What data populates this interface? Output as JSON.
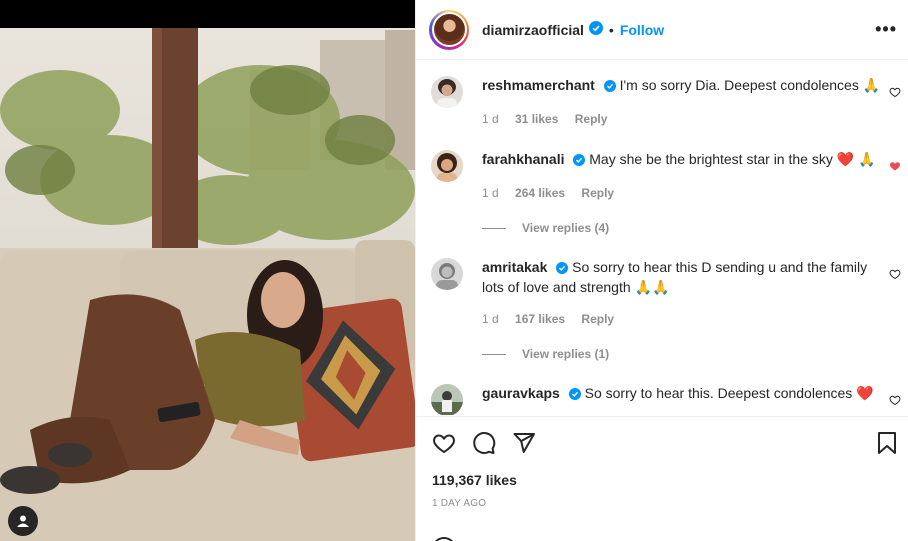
{
  "post": {
    "username": "diamirzaofficial",
    "follow_label": "Follow",
    "dot": "•",
    "more_label": "•••",
    "likes": "119,367 likes",
    "time_ago": "1 DAY AGO"
  },
  "comments": [
    {
      "username": "reshmamerchant",
      "text": "I'm so sorry Dia. Deepest condolences 🙏",
      "age": "1 d",
      "likes": "31 likes",
      "reply_label": "Reply",
      "liked": false
    },
    {
      "username": "farahkhanali",
      "text": "May she be the brightest star in the sky ❤️ 🙏",
      "age": "1 d",
      "likes": "264 likes",
      "reply_label": "Reply",
      "view_replies": "View replies (4)",
      "liked": true
    },
    {
      "username": "amritakak",
      "text": "So sorry to hear this D sending u and the family lots of love and strength 🙏🙏",
      "age": "1 d",
      "likes": "167 likes",
      "reply_label": "Reply",
      "view_replies": "View replies (1)",
      "liked": false
    },
    {
      "username": "gauravkaps",
      "text": "So sorry to hear this. Deepest condolences ❤️",
      "liked": false
    }
  ],
  "icons": {
    "verified": "verified-badge-icon",
    "like": "heart-icon",
    "comment": "comment-icon",
    "share": "share-icon",
    "save": "bookmark-icon",
    "tag": "user-tag-icon"
  },
  "colors": {
    "accent": "#0095f6",
    "liked": "#ed4956",
    "muted": "#8e8e8e",
    "text": "#262626"
  }
}
